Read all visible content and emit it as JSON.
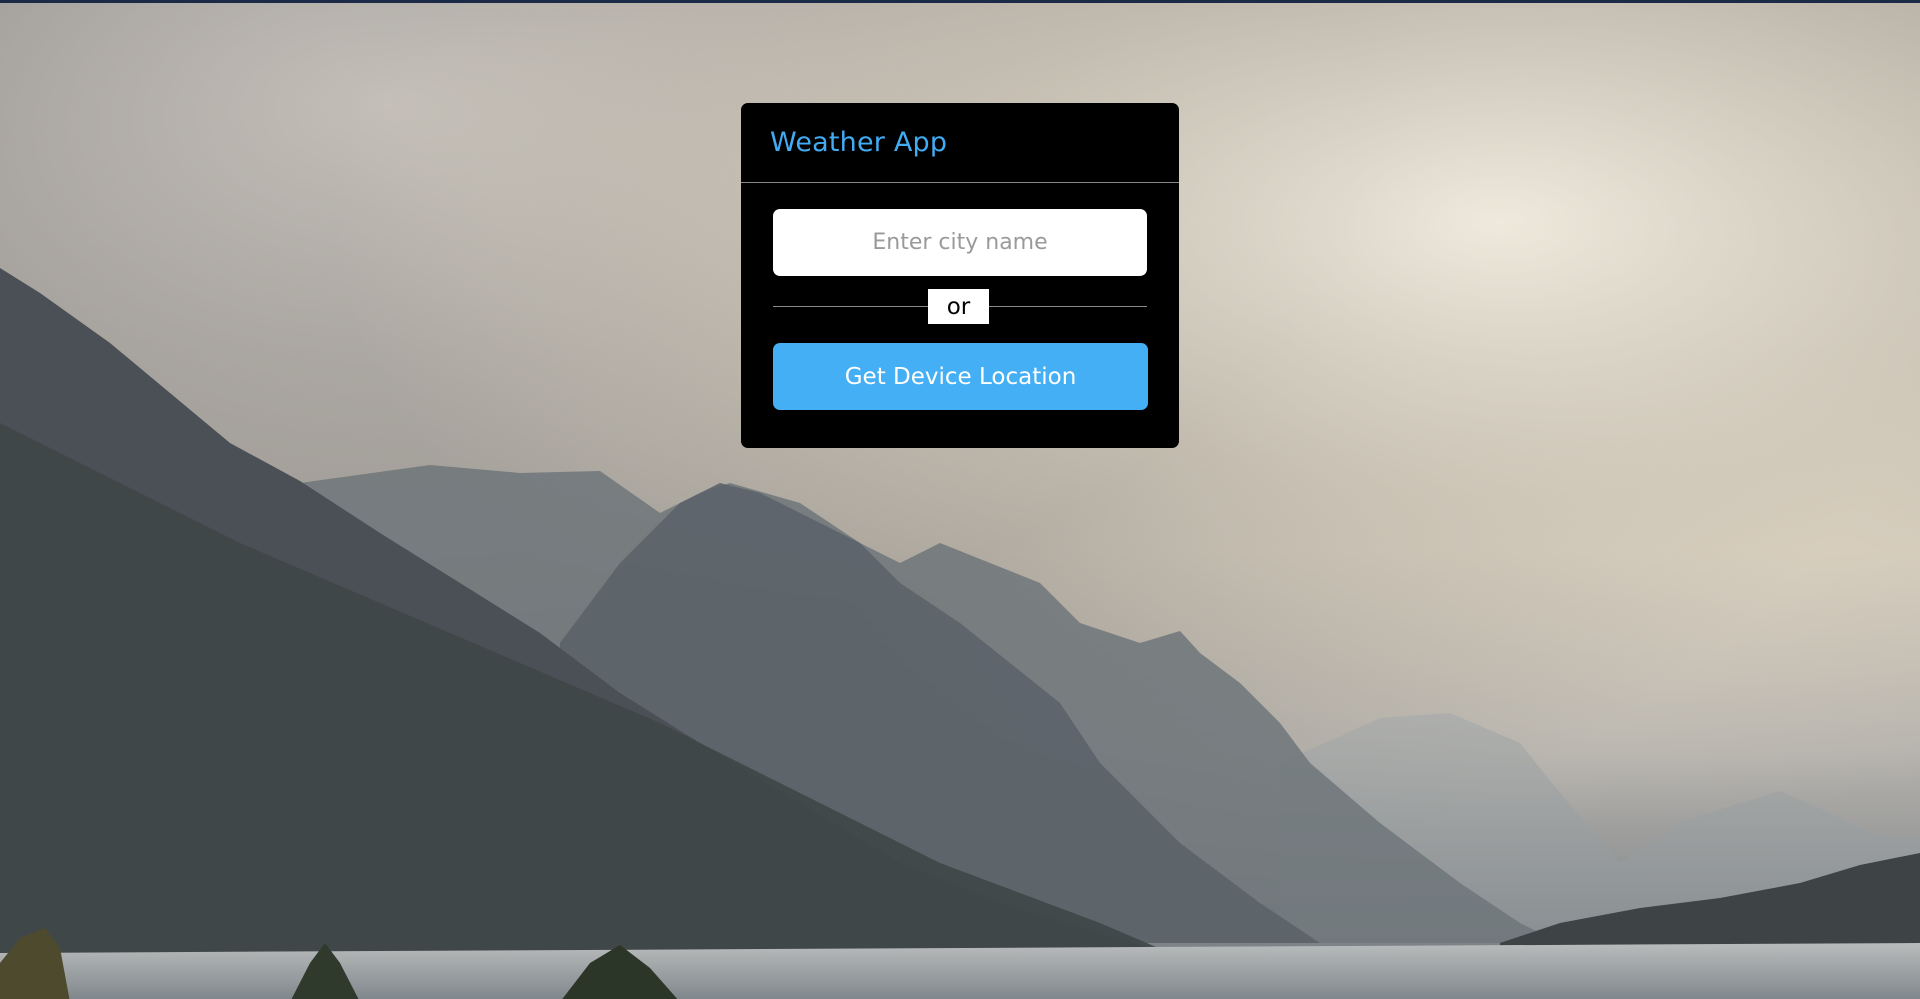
{
  "app": {
    "title": "Weather App"
  },
  "search": {
    "placeholder": "Enter city name",
    "value": ""
  },
  "divider": {
    "label": "or"
  },
  "actions": {
    "location_label": "Get Device Location"
  },
  "colors": {
    "accent": "#43abf2",
    "button": "#44aff5",
    "card": "#000000"
  }
}
